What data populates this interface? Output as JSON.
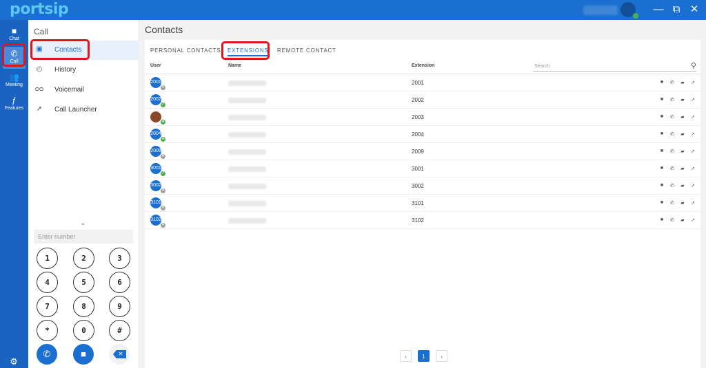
{
  "app": {
    "logo": "portsip"
  },
  "window": {
    "minimize": "—",
    "restore": "⧉",
    "close": "✕"
  },
  "rail": {
    "items": [
      {
        "label": "Chat",
        "icon": "chat-icon",
        "glyph": "■"
      },
      {
        "label": "Call",
        "icon": "phone-icon",
        "glyph": "✆"
      },
      {
        "label": "Meeting",
        "icon": "people-icon",
        "glyph": "👥"
      },
      {
        "label": "Features",
        "icon": "function-icon",
        "glyph": "ƒ"
      }
    ],
    "settings_glyph": "⚙"
  },
  "call_panel": {
    "title": "Call",
    "nav": [
      {
        "label": "Contacts",
        "icon": "contact-book-icon",
        "glyph": "▣"
      },
      {
        "label": "History",
        "icon": "clock-icon",
        "glyph": "◴"
      },
      {
        "label": "Voicemail",
        "icon": "voicemail-icon",
        "glyph": "ᴑᴑ"
      },
      {
        "label": "Call Launcher",
        "icon": "rocket-icon",
        "glyph": "➚"
      }
    ],
    "collapse_glyph": "⌄",
    "dialpad": {
      "placeholder": "Enter number",
      "keys": [
        "1",
        "2",
        "3",
        "4",
        "5",
        "6",
        "7",
        "8",
        "9",
        "*",
        "0",
        "#"
      ],
      "audio_call_glyph": "✆",
      "video_call_glyph": "■",
      "delete_glyph": "✕"
    }
  },
  "main": {
    "title": "Contacts",
    "tabs": [
      "PERSONAL CONTACTS",
      "EXTENSIONS",
      "REMOTE CONTACT"
    ],
    "columns": {
      "user": "User",
      "name": "Name",
      "extension": "Extension"
    },
    "search_placeholder": "Search",
    "search_glyph": "⚲",
    "rows": [
      {
        "avatar": "2001",
        "status": "offline",
        "extension": "2001"
      },
      {
        "avatar": "2002",
        "status": "online",
        "extension": "2002"
      },
      {
        "avatar": "",
        "status": "away",
        "extension": "2003"
      },
      {
        "avatar": "2004",
        "status": "away",
        "extension": "2004"
      },
      {
        "avatar": "2009",
        "status": "offline",
        "extension": "2009"
      },
      {
        "avatar": "3001",
        "status": "online",
        "extension": "3001"
      },
      {
        "avatar": "3002",
        "status": "offline",
        "extension": "3002"
      },
      {
        "avatar": "3101",
        "status": "offline",
        "extension": "3101"
      },
      {
        "avatar": "3102",
        "status": "offline",
        "extension": "3102"
      }
    ],
    "row_actions": {
      "message": "■",
      "call": "✆",
      "video": "▰",
      "launch": "➚"
    },
    "pagination": {
      "prev": "‹",
      "current": "1",
      "next": "›"
    }
  },
  "colors": {
    "brand": "#1b6fd1",
    "rail": "#1b63c0",
    "highlight": "#e0141b",
    "online": "#4caf50",
    "offline": "#9e9e9e"
  }
}
